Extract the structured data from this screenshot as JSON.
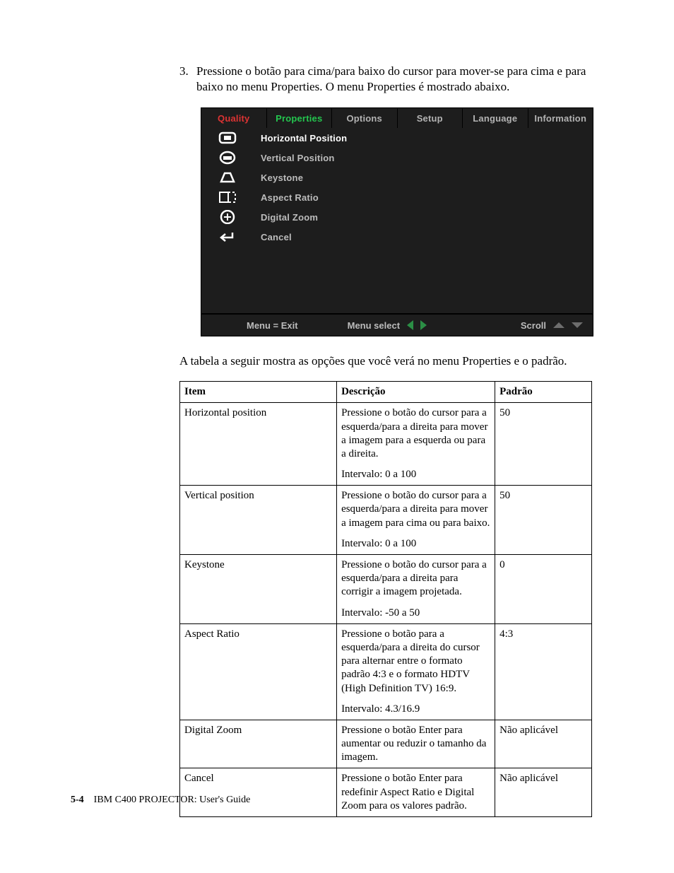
{
  "instruction": {
    "number": "3.",
    "text": "Pressione o botão para cima/para baixo do cursor para mover-se para cima e para baixo no menu Properties. O menu Properties é mostrado abaixo."
  },
  "osd": {
    "tabs": {
      "quality": "Quality",
      "properties": "Properties",
      "options": "Options",
      "setup": "Setup",
      "language": "Language",
      "information": "Information"
    },
    "items": {
      "hpos": "Horizontal Position",
      "vpos": "Vertical Position",
      "keystone": "Keystone",
      "aspect": "Aspect Ratio",
      "zoom": "Digital Zoom",
      "cancel": "Cancel"
    },
    "footer": {
      "exit": "Menu = Exit",
      "select": "Menu select",
      "scroll": "Scroll"
    }
  },
  "table_caption": "A tabela a seguir mostra as opções que você verá no menu Properties e o padrão.",
  "table": {
    "headers": {
      "item": "Item",
      "desc": "Descrição",
      "def": "Padrão"
    },
    "rows": [
      {
        "item": "Horizontal position",
        "desc": "Pressione o botão do cursor para a esquerda/para a direita para mover a imagem para a esquerda ou para a direita.",
        "range": "Intervalo: 0 a 100",
        "def": "50"
      },
      {
        "item": "Vertical position",
        "desc": "Pressione o botão do cursor para a esquerda/para a direita para mover a imagem para cima ou para baixo.",
        "range": "Intervalo: 0 a 100",
        "def": "50"
      },
      {
        "item": "Keystone",
        "desc": "Pressione o botão do cursor para a esquerda/para a direita para corrigir a imagem projetada.",
        "range": "Intervalo: -50 a 50",
        "def": "0"
      },
      {
        "item": "Aspect Ratio",
        "desc": "Pressione o botão para a esquerda/para a direita do cursor para alternar entre o formato padrão 4:3 e o formato HDTV (High Definition TV) 16:9.",
        "range": "Intervalo: 4.3/16.9",
        "def": "4:3"
      },
      {
        "item": "Digital Zoom",
        "desc": "Pressione o botão Enter para aumentar ou reduzir o tamanho da imagem.",
        "range": "",
        "def": "Não aplicável"
      },
      {
        "item": "Cancel",
        "desc": "Pressione o botão Enter para redefinir Aspect Ratio e Digital Zoom para os valores padrão.",
        "range": "",
        "def": "Não aplicável"
      }
    ]
  },
  "footer": {
    "page": "5-4",
    "title": "IBM C400 PROJECTOR: User's Guide"
  }
}
